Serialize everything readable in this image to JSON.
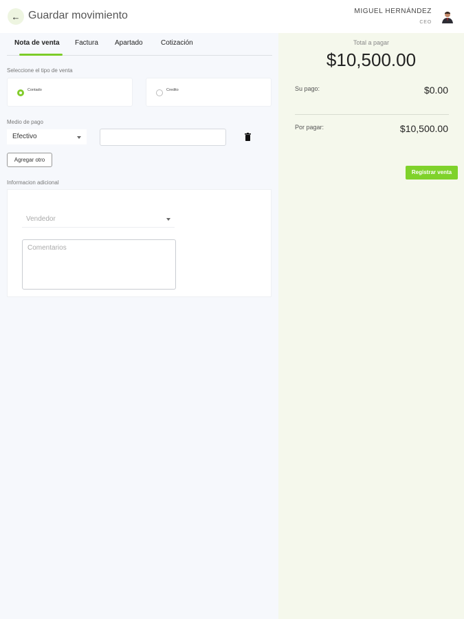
{
  "header": {
    "title": "Guardar movimiento",
    "back_icon": "arrow-left-icon",
    "user_name": "MIGUEL HERNÁNDEZ",
    "user_role": "CEO"
  },
  "tabs": [
    {
      "label": "Nota de venta",
      "active": true
    },
    {
      "label": "Factura",
      "active": false
    },
    {
      "label": "Apartado",
      "active": false
    },
    {
      "label": "Cotización",
      "active": false
    }
  ],
  "sale_type": {
    "label": "Seleccione el tipo de venta",
    "options": [
      {
        "label": "Contado",
        "checked": true
      },
      {
        "label": "Credito",
        "checked": false
      }
    ]
  },
  "payment": {
    "label": "Medio de pago",
    "method": "Efectivo",
    "amount_value": "",
    "add_label": "Agregar otro"
  },
  "additional": {
    "label": "Informacion adicional",
    "vendor_placeholder": "Vendedor",
    "comments_placeholder": "Comentarios"
  },
  "summary": {
    "total_label": "Total a pagar",
    "total_value": "$10,500.00",
    "paid_label": "Su pago:",
    "paid_value": "$0.00",
    "due_label": "Por pagar:",
    "due_value": "$10,500.00",
    "register_label": "Registrar venta"
  },
  "colors": {
    "accent": "#7fd22b",
    "summary_bg": "#f5f8ec",
    "page_bg": "#f6f8fc"
  }
}
